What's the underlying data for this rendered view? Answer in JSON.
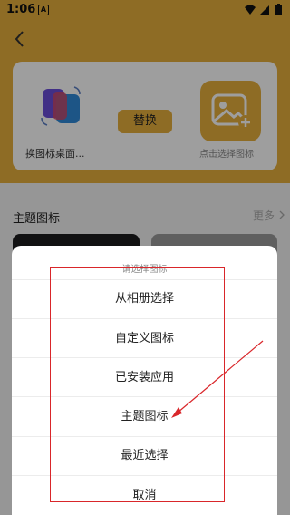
{
  "status_bar": {
    "time": "1:06",
    "notification_icon": "A"
  },
  "card": {
    "app_name": "换图标桌面...",
    "replace_button": "替换",
    "pick_label": "点击选择图标"
  },
  "section": {
    "title": "主题图标",
    "more": "更多"
  },
  "sheet": {
    "title": "请选择图标",
    "items": [
      "从相册选择",
      "自定义图标",
      "已安装应用",
      "主题图标",
      "最近选择"
    ],
    "cancel": "取消"
  },
  "colors": {
    "accent": "#e6ae3d",
    "annotation": "#d9262a"
  },
  "icons": [
    "back-arrow-icon",
    "image-plus-icon",
    "wifi-icon",
    "signal-icon",
    "battery-icon",
    "chevron-right-icon"
  ]
}
